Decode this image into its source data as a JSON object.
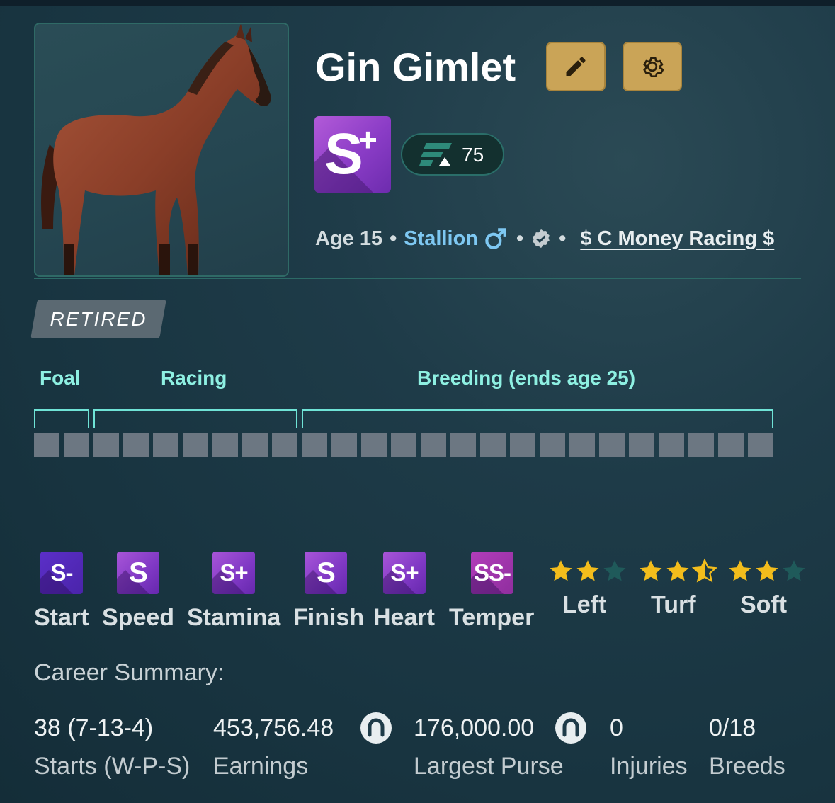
{
  "horse": {
    "name": "Gin Gimlet",
    "grade": "S",
    "grade_modifier": "+",
    "rating": "75",
    "age_text": "Age 15",
    "sex": "Stallion",
    "sex_icon": "male-symbol",
    "owner": "$ C Money Racing $",
    "status": "RETIRED"
  },
  "header_actions": {
    "edit_icon": "pencil-icon",
    "settings_icon": "gear-icon"
  },
  "lifecycle": {
    "phases": [
      {
        "label": "Foal"
      },
      {
        "label": "Racing"
      },
      {
        "label": "Breeding (ends age 25)"
      }
    ],
    "total_years": 25,
    "current_age": 15
  },
  "traits": [
    {
      "grade": "S-",
      "label": "Start"
    },
    {
      "grade": "S",
      "label": "Speed"
    },
    {
      "grade": "S+",
      "label": "Stamina"
    },
    {
      "grade": "S",
      "label": "Finish"
    },
    {
      "grade": "S+",
      "label": "Heart"
    },
    {
      "grade": "SS-",
      "label": "Temper"
    }
  ],
  "preferences": [
    {
      "label": "Left",
      "stars": 2,
      "max": 3
    },
    {
      "label": "Turf",
      "stars": 2.5,
      "max": 3
    },
    {
      "label": "Soft",
      "stars": 2,
      "max": 3
    }
  ],
  "career": {
    "title": "Career Summary:",
    "stats": [
      {
        "value": "38 (7-13-4)",
        "label": "Starts (W-P-S)"
      },
      {
        "value": "453,756.48",
        "label": "Earnings",
        "currency_icon": "horseshoe-coin-icon"
      },
      {
        "value": "176,000.00",
        "label": "Largest Purse",
        "currency_icon": "horseshoe-coin-icon"
      },
      {
        "value": "0",
        "label": "Injuries"
      },
      {
        "value": "0/18",
        "label": "Breeds"
      }
    ]
  },
  "colors": {
    "accent_teal": "#6fe3d6",
    "gold_button": "#caa457",
    "grade_purple": "#8a3cc6",
    "star_gold": "#f3bd1c",
    "star_empty": "#1f5a5a"
  }
}
